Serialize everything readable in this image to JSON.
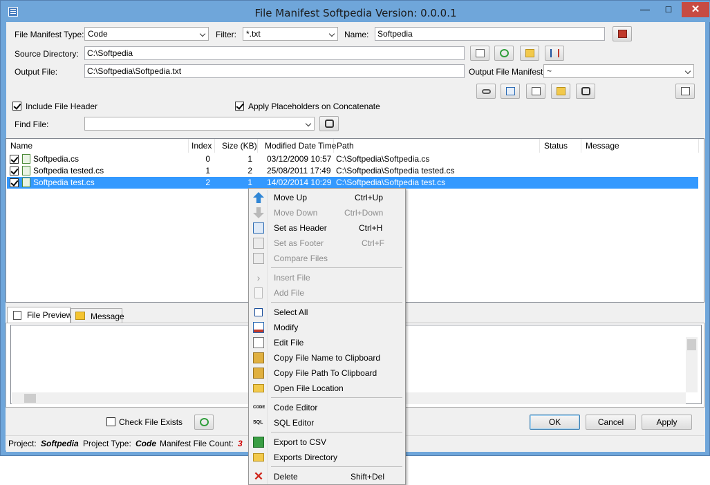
{
  "window": {
    "title": "File Manifest Softpedia Version: 0.0.0.1",
    "minimize": "—",
    "maximize": "□",
    "close": "✕"
  },
  "form": {
    "type_label": "File Manifest Type:",
    "type_value": "Code",
    "filter_label": "Filter:",
    "filter_value": "*.txt",
    "name_label": "Name:",
    "name_value": "Softpedia",
    "source_label": "Source Directory:",
    "source_value": "C:\\Softpedia",
    "output_label": "Output File:",
    "output_value": "C:\\Softpedia\\Softpedia.txt",
    "manifest_label": "Output File Manifest:",
    "manifest_value": "~",
    "include_header_label": "Include File Header",
    "apply_placeholders_label": "Apply Placeholders on Concatenate",
    "find_label": "Find File:",
    "find_value": ""
  },
  "columns": [
    "Name",
    "Index",
    "Size (KB)",
    "Modified Date Time",
    "Path",
    "Status",
    "Message"
  ],
  "rows": [
    {
      "name": "Softpedia.cs",
      "index": "0",
      "size": "1",
      "date": "03/12/2009 10:57",
      "path": "C:\\Softpedia\\Softpedia.cs"
    },
    {
      "name": "Softpedia tested.cs",
      "index": "1",
      "size": "2",
      "date": "25/08/2011 17:49",
      "path": "C:\\Softpedia\\Softpedia tested.cs"
    },
    {
      "name": "Softpedia test.cs",
      "index": "2",
      "size": "1",
      "date": "14/02/2014 10:29",
      "path": "C:\\Softpedia\\Softpedia test.cs"
    }
  ],
  "tabs": {
    "preview": "File Preview",
    "message": "Message"
  },
  "bottom": {
    "check_file_exists": "Check File Exists",
    "ok": "OK",
    "cancel": "Cancel",
    "apply": "Apply"
  },
  "status": {
    "project_label": "Project:",
    "project_value": "Softpedia",
    "type_label": "Project Type:",
    "type_value": "Code",
    "count_label": "Manifest File Count:",
    "count_value": "3"
  },
  "menu": {
    "move_up": "Move Up",
    "move_up_key": "Ctrl+Up",
    "move_down": "Move Down",
    "move_down_key": "Ctrl+Down",
    "set_header": "Set as Header",
    "set_header_key": "Ctrl+H",
    "set_footer": "Set as Footer",
    "set_footer_key": "Ctrl+F",
    "compare": "Compare Files",
    "insert": "Insert File",
    "add": "Add File",
    "select_all": "Select All",
    "modify": "Modify",
    "edit": "Edit File",
    "copy_name": "Copy File Name to Clipboard",
    "copy_path": "Copy File Path To Clipboard",
    "open_loc": "Open File Location",
    "code_editor": "Code Editor",
    "sql_editor": "SQL Editor",
    "export_csv": "Export to CSV",
    "exports_dir": "Exports Directory",
    "delete": "Delete",
    "delete_key": "Shift+Del",
    "code_glyph": "CODE",
    "sql_glyph": "SQL"
  }
}
